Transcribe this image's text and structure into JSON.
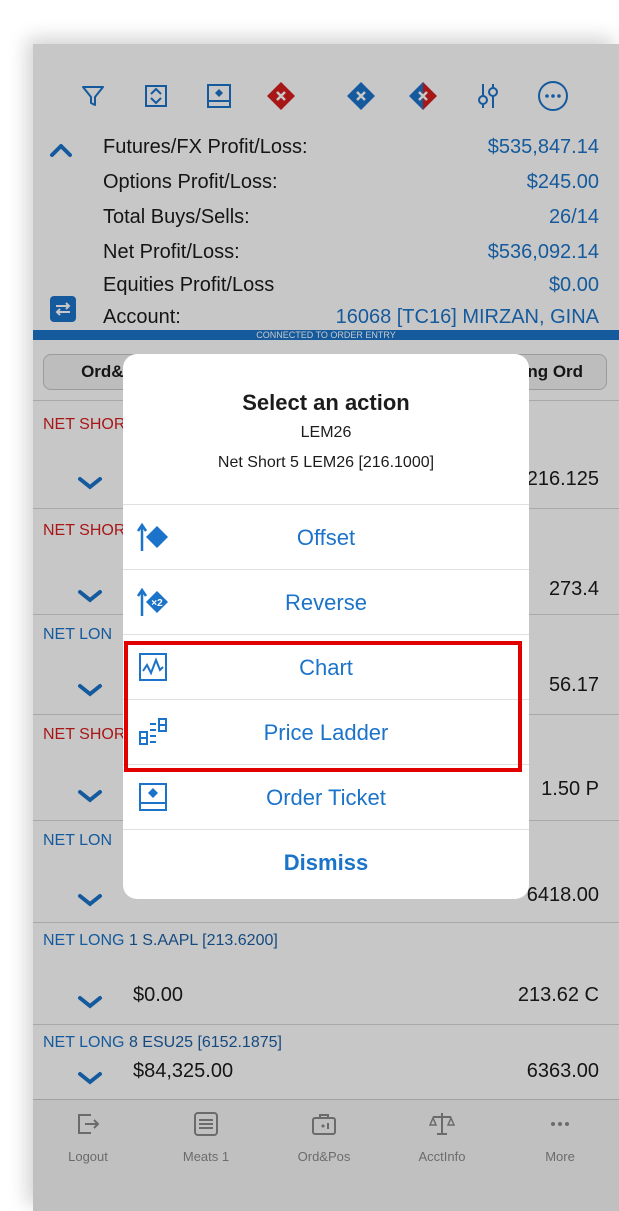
{
  "toolbar": {
    "icons": [
      "filter-icon",
      "expand-collapse-icon",
      "order-ticket-icon",
      "cancel-sells-icon",
      "cancel-buys-icon",
      "cancel-all-icon",
      "settings-sliders-icon",
      "more-circle-icon"
    ]
  },
  "summary": {
    "futures_label": "Futures/FX Profit/Loss:",
    "futures_value": "$535,847.14",
    "options_label": "Options Profit/Loss:",
    "options_value": "$245.00",
    "buys_label": "Total Buys/Sells:",
    "buys_value": "26/14",
    "net_label": "Net Profit/Loss:",
    "net_value": "$536,092.14",
    "equities_label": "Equities Profit/Loss",
    "equities_value": "$0.00",
    "account_label": "Account:",
    "account_value": "16068 [TC16] MIRZAN, GINA"
  },
  "connection_status": "CONNECTED TO ORDER ENTRY",
  "tabs": {
    "left": "Ord&P",
    "right": "ting Ord"
  },
  "positions": [
    {
      "side": "NET SHOR",
      "desc": "",
      "pl": "",
      "price": "216.125"
    },
    {
      "side": "NET SHOR",
      "desc": "",
      "pl": "",
      "price": "273.4"
    },
    {
      "side": "NET LON",
      "desc": "",
      "pl": "",
      "price": "56.17"
    },
    {
      "side": "NET SHOR",
      "desc": "",
      "pl": "",
      "price": "1.50 P"
    },
    {
      "side": "NET LON",
      "desc": "",
      "pl": "",
      "price": "6418.00"
    },
    {
      "side": "NET LONG",
      "desc": "1 S.AAPL [213.6200]",
      "pl": "$0.00",
      "price": "213.62 C"
    },
    {
      "side": "NET LONG",
      "desc": "8 ESU25 [6152.1875]",
      "pl": "$84,325.00",
      "price": "6363.00"
    }
  ],
  "bottom_nav": {
    "logout": "Logout",
    "meats": "Meats 1",
    "ordpos": "Ord&Pos",
    "acctinfo": "AcctInfo",
    "more": "More"
  },
  "sheet": {
    "title": "Select an action",
    "symbol": "LEM26",
    "detail": "Net Short 5 LEM26 [216.1000]",
    "actions": {
      "offset": "Offset",
      "reverse": "Reverse",
      "chart": "Chart",
      "price_ladder": "Price Ladder",
      "order_ticket": "Order Ticket",
      "dismiss": "Dismiss"
    }
  },
  "colors": {
    "accent": "#1b74c9",
    "short": "#d81e1e",
    "highlight": "#e00000"
  }
}
